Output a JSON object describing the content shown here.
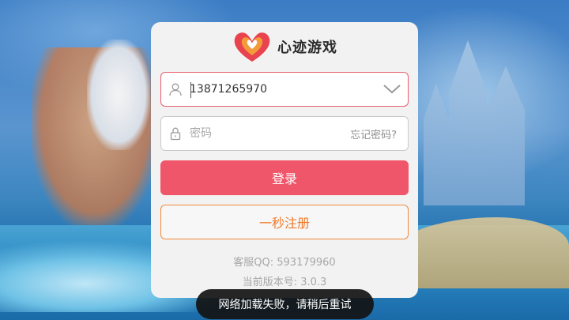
{
  "app": {
    "brand_name": "心迹游戏",
    "brand_color": "#e8434f"
  },
  "login": {
    "account_value": "13871265970",
    "password_placeholder": "密码",
    "forgot_password_label": "忘记密码?",
    "login_button_label": "登录",
    "register_button_label": "一秒注册",
    "accent_color": "#f0566a",
    "register_color": "#f07a2a"
  },
  "footer": {
    "customer_service": "客服QQ: 593179960",
    "version": "当前版本号: 3.0.3"
  },
  "toast": {
    "message": "网络加载失败，请稍后重试"
  },
  "icons": {
    "account": "user-icon",
    "password": "lock-icon",
    "dropdown": "chevron-down-icon",
    "logo": "heart-logo-icon"
  }
}
